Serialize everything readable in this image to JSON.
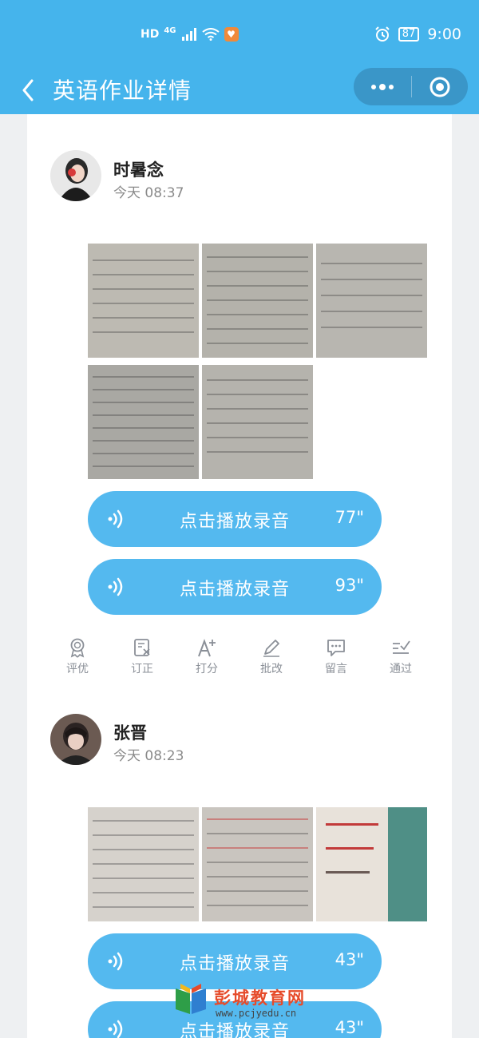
{
  "status_bar": {
    "net_hd": "HD",
    "net_4g": "4G",
    "battery": "87",
    "time": "9:00"
  },
  "nav": {
    "title": "英语作业详情"
  },
  "submissions": [
    {
      "name": "时暑念",
      "time": "今天 08:37",
      "recordings": [
        {
          "label": "点击播放录音",
          "duration": "77\""
        },
        {
          "label": "点击播放录音",
          "duration": "93\""
        }
      ]
    },
    {
      "name": "张晋",
      "time": "今天 08:23",
      "recordings": [
        {
          "label": "点击播放录音",
          "duration": "43\""
        },
        {
          "label": "点击播放录音",
          "duration": "43\""
        }
      ]
    }
  ],
  "actions": [
    {
      "label": "评优",
      "icon": "award-icon"
    },
    {
      "label": "订正",
      "icon": "correct-icon"
    },
    {
      "label": "打分",
      "icon": "score-icon"
    },
    {
      "label": "批改",
      "icon": "pencil-icon"
    },
    {
      "label": "留言",
      "icon": "message-icon"
    },
    {
      "label": "通过",
      "icon": "approve-icon"
    }
  ],
  "watermark": {
    "text": "彭城教育网",
    "url": "www.pcjyedu.cn"
  },
  "colors": {
    "primary": "#45b4ec",
    "button": "#54b9ef",
    "watermark": "#e64b2a"
  }
}
